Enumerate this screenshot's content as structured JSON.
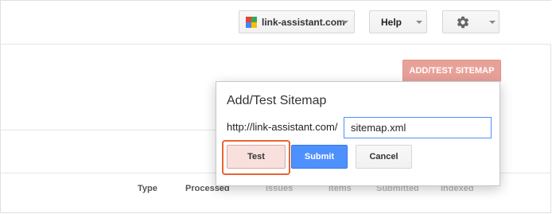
{
  "header": {
    "site_selector": {
      "label": "link-assistant.com",
      "icon": "link-assistant-logo-icon"
    },
    "help_label": "Help",
    "settings_icon": "gear-icon"
  },
  "page": {
    "add_sitemap_label": "ADD/TEST SITEMAP",
    "table_headers": [
      "Type",
      "Processed",
      "Issues",
      "Items",
      "Submitted",
      "Indexed"
    ]
  },
  "dialog": {
    "title": "Add/Test Sitemap",
    "url_prefix": "http://link-assistant.com/",
    "input_value": "sitemap.xml",
    "test_label": "Test",
    "submit_label": "Submit",
    "cancel_label": "Cancel"
  },
  "colors": {
    "primary_blue": "#4d90fe",
    "add_sitemap_red": "#e8a199",
    "highlight_orange": "#e8652f",
    "logo": [
      "#e94235",
      "#34a853",
      "#4285f4",
      "#fbbc05"
    ]
  }
}
